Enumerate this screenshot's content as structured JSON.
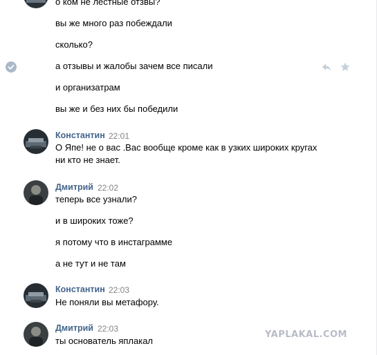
{
  "messages_top": {
    "top_avatar_fragment": "",
    "m0": "о ком не лестные отзвы?",
    "m1": "вы же много раз побеждали",
    "m2": "сколько?",
    "m3": "а отзывы и жалобы зачем все писали",
    "m4": "и организатрам",
    "m5": "вы же и без них бы победили"
  },
  "groups": [
    {
      "author": "Константин",
      "time": "22:01",
      "lines": [
        "О Япе! не о вас .Вас вообще кроме как в узких широких кругах",
        "ни кто не знает."
      ]
    },
    {
      "author": "Дмитрий",
      "time": "22:02",
      "lines": [
        "теперь все узнали?",
        "и в широких тоже?",
        "я потому что в инстаграмме",
        "а не тут и не там"
      ]
    },
    {
      "author": "Константин",
      "time": "22:03",
      "lines": [
        "Не поняли вы метафору."
      ]
    },
    {
      "author": "Дмитрий",
      "time": "22:03",
      "lines": [
        "ты основатель яплакал"
      ]
    }
  ],
  "icons": {
    "selected": "check-circle-icon",
    "reply": "reply-arrow-icon",
    "favorite": "star-icon"
  },
  "watermark": "YAPLAKAL.COM",
  "colors": {
    "author": "#42648b",
    "time": "#828282",
    "icon": "#c5d0db",
    "check": "#aab8c8"
  }
}
